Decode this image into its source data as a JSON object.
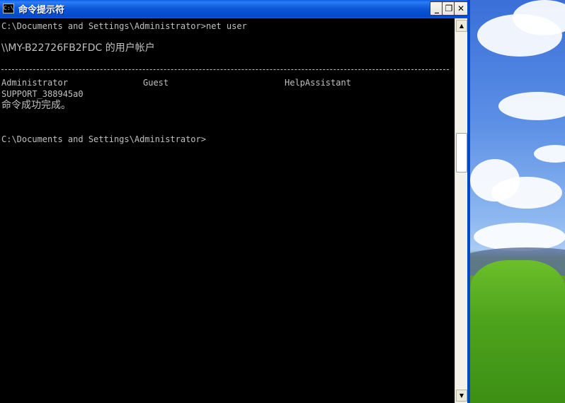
{
  "window": {
    "title": "命令提示符",
    "icon_label": "C:\\"
  },
  "controls": {
    "minimize": "_",
    "restore": "❐",
    "close": "✕"
  },
  "console": {
    "line1": "C:\\Documents and Settings\\Administrator>net user",
    "line2": "\\\\MY-B22726FB2FDC 的用户帐户",
    "users_row1_col1": "Administrator",
    "users_row1_col2": "Guest",
    "users_row1_col3": "HelpAssistant",
    "users_row2_col1": "SUPPORT_388945a0",
    "status": "命令成功完成。",
    "prompt": "C:\\Documents and Settings\\Administrator>"
  },
  "scrollbar": {
    "up_arrow": "▲",
    "down_arrow": "▼"
  }
}
